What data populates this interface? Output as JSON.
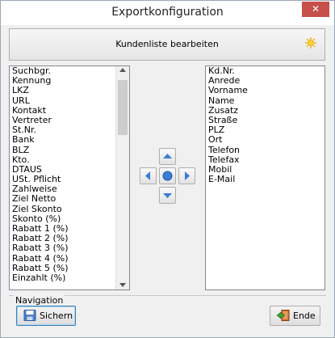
{
  "window": {
    "title": "Exportkonfiguration",
    "close_label": "✕"
  },
  "header": {
    "label": "Kundenliste bearbeiten",
    "icon": "sun-icon"
  },
  "left_list": {
    "items": [
      "Suchbgr.",
      "Kennung",
      "LKZ",
      "URL",
      "Kontakt",
      "Vertreter",
      "St.Nr.",
      "Bank",
      "BLZ",
      "Kto.",
      "DTAUS",
      "USt. Pflicht",
      "Zahlweise",
      "Ziel Netto",
      "Ziel Skonto",
      "Skonto (%)",
      "Rabatt 1 (%)",
      "Rabatt 2 (%)",
      "Rabatt 3 (%)",
      "Rabatt 4 (%)",
      "Rabatt 5 (%)",
      "Einzahlt (%)"
    ]
  },
  "right_list": {
    "items": [
      "Kd.Nr.",
      "Anrede",
      "Vorname",
      "Name",
      "Zusatz",
      "Straße",
      "PLZ",
      "Ort",
      "Telefon",
      "Telefax",
      "Mobil",
      "E-Mail"
    ]
  },
  "navigation": {
    "group_label": "Navigation",
    "save_label": "Sichern",
    "end_label": "Ende"
  },
  "colors": {
    "arrow_blue": "#3b7dd8",
    "close_red": "#c7504b"
  }
}
